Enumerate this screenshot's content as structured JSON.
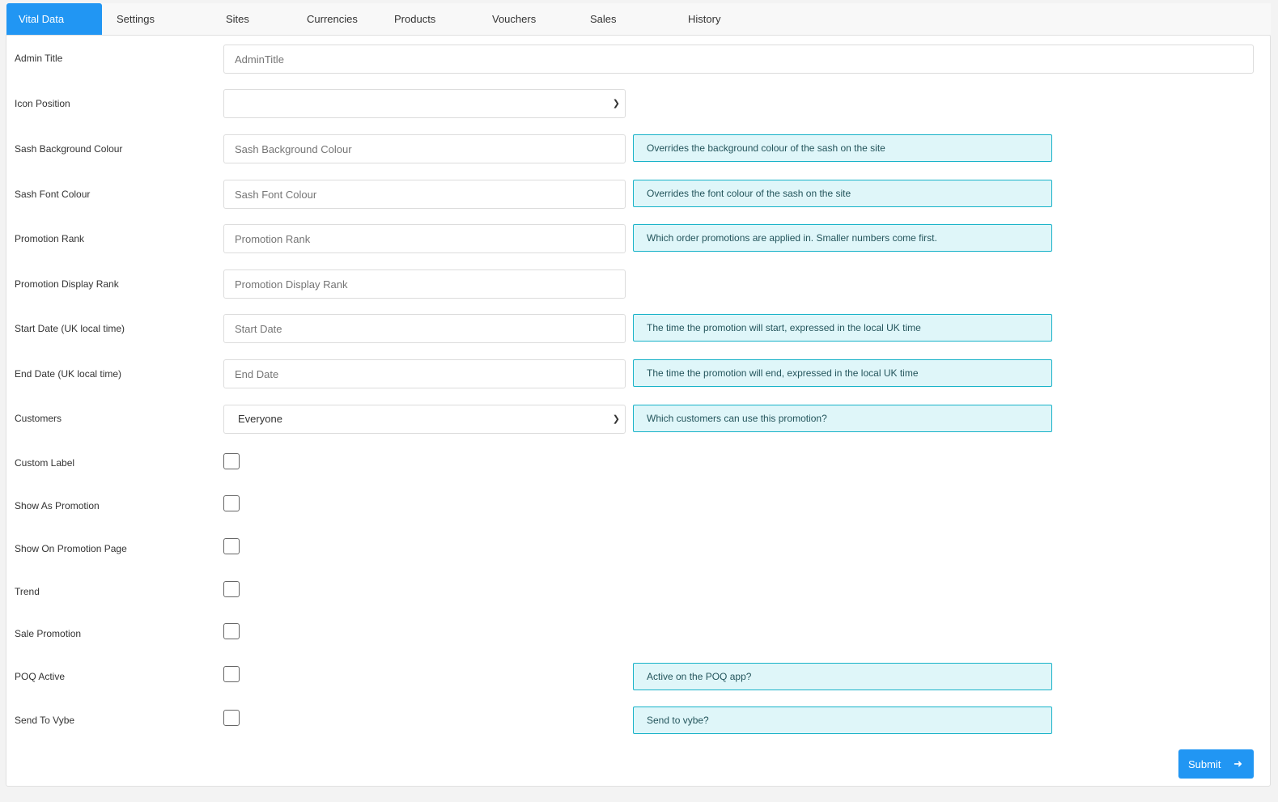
{
  "tabs": [
    {
      "label": "Vital Data",
      "active": true
    },
    {
      "label": "Settings",
      "active": false
    },
    {
      "label": "Sites",
      "active": false
    },
    {
      "label": "Currencies",
      "active": false
    },
    {
      "label": "Products",
      "active": false
    },
    {
      "label": "Vouchers",
      "active": false
    },
    {
      "label": "Sales",
      "active": false
    },
    {
      "label": "History",
      "active": false
    }
  ],
  "fields": {
    "admin_title": {
      "label": "Admin Title",
      "placeholder": "AdminTitle"
    },
    "icon_position": {
      "label": "Icon Position",
      "value": ""
    },
    "sash_background_colour": {
      "label": "Sash Background Colour",
      "placeholder": "Sash Background Colour",
      "help": "Overrides the background colour of the sash on the site"
    },
    "sash_font_colour": {
      "label": "Sash Font Colour",
      "placeholder": "Sash Font Colour",
      "help": "Overrides the font colour of the sash on the site"
    },
    "promotion_rank": {
      "label": "Promotion Rank",
      "placeholder": "Promotion Rank",
      "help": "Which order promotions are applied in. Smaller numbers come first."
    },
    "promotion_display_rank": {
      "label": "Promotion Display Rank",
      "placeholder": "Promotion Display Rank"
    },
    "start_date": {
      "label": "Start Date (UK local time)",
      "placeholder": "Start Date",
      "help": "The time the promotion will start, expressed in the local UK time"
    },
    "end_date": {
      "label": "End Date (UK local time)",
      "placeholder": "End Date",
      "help": "The time the promotion will end, expressed in the local UK time"
    },
    "customers": {
      "label": "Customers",
      "value": "Everyone",
      "help": "Which customers can use this promotion?"
    }
  },
  "checkboxes": {
    "custom_label": {
      "label": "Custom Label",
      "checked": false
    },
    "show_as_promotion": {
      "label": "Show As Promotion",
      "checked": false
    },
    "show_on_promotion_page": {
      "label": "Show On Promotion Page",
      "checked": false
    },
    "trend": {
      "label": "Trend",
      "checked": false
    },
    "sale_promotion": {
      "label": "Sale Promotion",
      "checked": false
    },
    "poq_active": {
      "label": "POQ Active",
      "checked": false,
      "help": "Active on the POQ app?"
    },
    "send_to_vybe": {
      "label": "Send To Vybe",
      "checked": false,
      "help": "Send to vybe?"
    }
  },
  "submit": {
    "label": "Submit",
    "icon": "arrow-right-icon"
  },
  "colors": {
    "accent": "#2196f3",
    "help_bg": "#dff6f9",
    "help_border": "#17b2c8"
  }
}
